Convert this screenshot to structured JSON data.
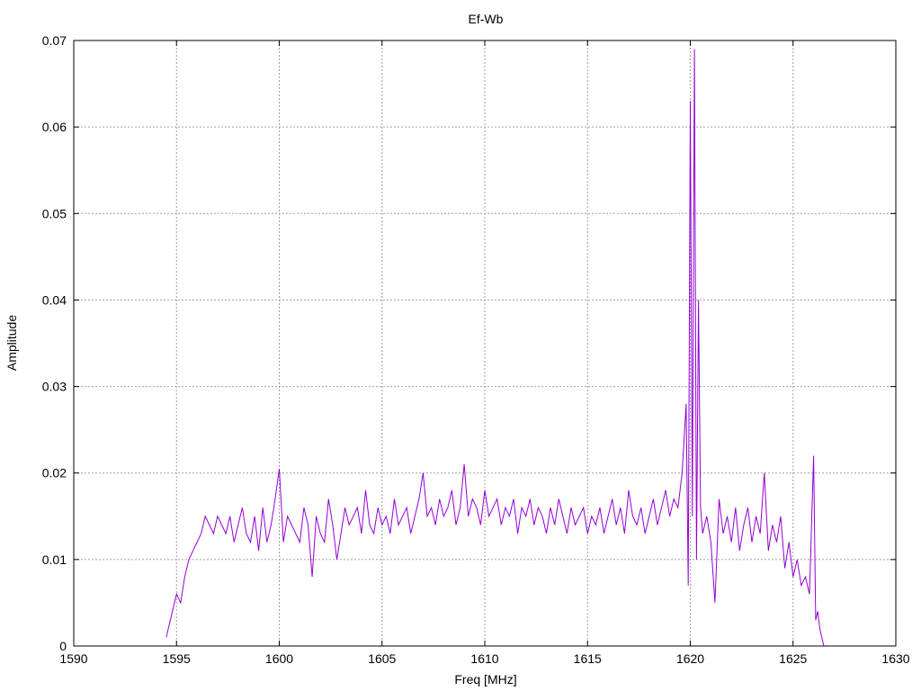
{
  "chart_data": {
    "type": "line",
    "title": "Ef-Wb",
    "xlabel": "Freq [MHz]",
    "ylabel": "Amplitude",
    "xlim": [
      1590,
      1630
    ],
    "ylim": [
      0,
      0.07
    ],
    "xticks": [
      1590,
      1595,
      1600,
      1605,
      1610,
      1615,
      1620,
      1625,
      1630
    ],
    "yticks": [
      0,
      0.01,
      0.02,
      0.03,
      0.04,
      0.05,
      0.06,
      0.07
    ],
    "ytick_labels": [
      "0",
      "0.01",
      "0.02",
      "0.03",
      "0.04",
      "0.05",
      "0.06",
      "0.07"
    ],
    "grid": true,
    "legend": "none",
    "series": [
      {
        "color": "#9400d3",
        "x": [
          1594.5,
          1594.8,
          1595.0,
          1595.2,
          1595.4,
          1595.6,
          1595.8,
          1596.0,
          1596.2,
          1596.4,
          1596.6,
          1596.8,
          1597.0,
          1597.2,
          1597.4,
          1597.6,
          1597.8,
          1598.0,
          1598.2,
          1598.4,
          1598.6,
          1598.8,
          1599.0,
          1599.2,
          1599.4,
          1599.6,
          1599.8,
          1600.0,
          1600.2,
          1600.4,
          1600.6,
          1600.8,
          1601.0,
          1601.2,
          1601.4,
          1601.6,
          1601.8,
          1602.0,
          1602.2,
          1602.4,
          1602.6,
          1602.8,
          1603.0,
          1603.2,
          1603.4,
          1603.6,
          1603.8,
          1604.0,
          1604.2,
          1604.4,
          1604.6,
          1604.8,
          1605.0,
          1605.2,
          1605.4,
          1605.6,
          1605.8,
          1606.0,
          1606.2,
          1606.4,
          1606.6,
          1606.8,
          1607.0,
          1607.2,
          1607.4,
          1607.6,
          1607.8,
          1608.0,
          1608.2,
          1608.4,
          1608.6,
          1608.8,
          1609.0,
          1609.2,
          1609.4,
          1609.6,
          1609.8,
          1610.0,
          1610.2,
          1610.4,
          1610.6,
          1610.8,
          1611.0,
          1611.2,
          1611.4,
          1611.6,
          1611.8,
          1612.0,
          1612.2,
          1612.4,
          1612.6,
          1612.8,
          1613.0,
          1613.2,
          1613.4,
          1613.6,
          1613.8,
          1614.0,
          1614.2,
          1614.4,
          1614.6,
          1614.8,
          1615.0,
          1615.2,
          1615.4,
          1615.6,
          1615.8,
          1616.0,
          1616.2,
          1616.4,
          1616.6,
          1616.8,
          1617.0,
          1617.2,
          1617.4,
          1617.6,
          1617.8,
          1618.0,
          1618.2,
          1618.4,
          1618.6,
          1618.8,
          1619.0,
          1619.2,
          1619.4,
          1619.6,
          1619.8,
          1619.9,
          1620.0,
          1620.1,
          1620.2,
          1620.3,
          1620.4,
          1620.5,
          1620.6,
          1620.8,
          1621.0,
          1621.2,
          1621.4,
          1621.6,
          1621.8,
          1622.0,
          1622.2,
          1622.4,
          1622.6,
          1622.8,
          1623.0,
          1623.2,
          1623.4,
          1623.6,
          1623.8,
          1624.0,
          1624.2,
          1624.4,
          1624.6,
          1624.8,
          1625.0,
          1625.2,
          1625.4,
          1625.6,
          1625.8,
          1626.0,
          1626.1,
          1626.2,
          1626.3,
          1626.4,
          1626.5
        ],
        "y": [
          0.001,
          0.004,
          0.006,
          0.005,
          0.008,
          0.01,
          0.011,
          0.012,
          0.013,
          0.015,
          0.014,
          0.013,
          0.015,
          0.014,
          0.013,
          0.015,
          0.012,
          0.014,
          0.016,
          0.013,
          0.012,
          0.015,
          0.011,
          0.016,
          0.012,
          0.014,
          0.017,
          0.0205,
          0.012,
          0.015,
          0.014,
          0.013,
          0.012,
          0.016,
          0.014,
          0.008,
          0.015,
          0.013,
          0.012,
          0.017,
          0.014,
          0.01,
          0.013,
          0.016,
          0.014,
          0.015,
          0.016,
          0.013,
          0.018,
          0.014,
          0.013,
          0.016,
          0.014,
          0.015,
          0.013,
          0.017,
          0.014,
          0.015,
          0.016,
          0.013,
          0.015,
          0.017,
          0.02,
          0.015,
          0.016,
          0.014,
          0.017,
          0.015,
          0.016,
          0.018,
          0.014,
          0.016,
          0.021,
          0.015,
          0.017,
          0.016,
          0.014,
          0.018,
          0.015,
          0.016,
          0.017,
          0.014,
          0.016,
          0.015,
          0.017,
          0.013,
          0.016,
          0.015,
          0.017,
          0.014,
          0.016,
          0.015,
          0.013,
          0.016,
          0.014,
          0.017,
          0.015,
          0.013,
          0.016,
          0.014,
          0.015,
          0.016,
          0.013,
          0.015,
          0.014,
          0.016,
          0.013,
          0.015,
          0.017,
          0.014,
          0.016,
          0.013,
          0.018,
          0.015,
          0.014,
          0.016,
          0.013,
          0.015,
          0.017,
          0.014,
          0.016,
          0.018,
          0.015,
          0.017,
          0.016,
          0.02,
          0.028,
          0.007,
          0.063,
          0.015,
          0.069,
          0.01,
          0.04,
          0.016,
          0.013,
          0.015,
          0.012,
          0.005,
          0.017,
          0.013,
          0.015,
          0.012,
          0.016,
          0.011,
          0.014,
          0.016,
          0.012,
          0.015,
          0.013,
          0.02,
          0.011,
          0.014,
          0.012,
          0.015,
          0.009,
          0.012,
          0.008,
          0.01,
          0.007,
          0.008,
          0.006,
          0.022,
          0.003,
          0.004,
          0.002,
          0.001,
          0.0
        ]
      }
    ]
  }
}
